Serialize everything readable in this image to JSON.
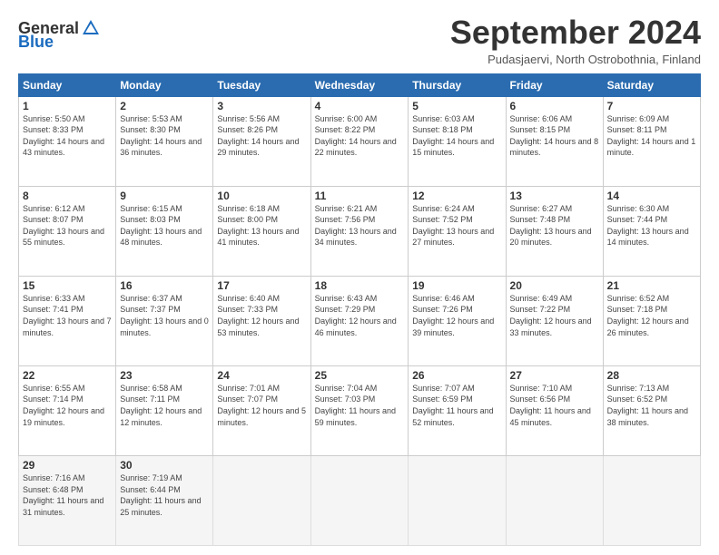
{
  "header": {
    "logo_general": "General",
    "logo_blue": "Blue",
    "month_title": "September 2024",
    "subtitle": "Pudasjaervi, North Ostrobothnia, Finland"
  },
  "weekdays": [
    "Sunday",
    "Monday",
    "Tuesday",
    "Wednesday",
    "Thursday",
    "Friday",
    "Saturday"
  ],
  "weeks": [
    [
      {
        "day": "1",
        "sunrise": "Sunrise: 5:50 AM",
        "sunset": "Sunset: 8:33 PM",
        "daylight": "Daylight: 14 hours and 43 minutes."
      },
      {
        "day": "2",
        "sunrise": "Sunrise: 5:53 AM",
        "sunset": "Sunset: 8:30 PM",
        "daylight": "Daylight: 14 hours and 36 minutes."
      },
      {
        "day": "3",
        "sunrise": "Sunrise: 5:56 AM",
        "sunset": "Sunset: 8:26 PM",
        "daylight": "Daylight: 14 hours and 29 minutes."
      },
      {
        "day": "4",
        "sunrise": "Sunrise: 6:00 AM",
        "sunset": "Sunset: 8:22 PM",
        "daylight": "Daylight: 14 hours and 22 minutes."
      },
      {
        "day": "5",
        "sunrise": "Sunrise: 6:03 AM",
        "sunset": "Sunset: 8:18 PM",
        "daylight": "Daylight: 14 hours and 15 minutes."
      },
      {
        "day": "6",
        "sunrise": "Sunrise: 6:06 AM",
        "sunset": "Sunset: 8:15 PM",
        "daylight": "Daylight: 14 hours and 8 minutes."
      },
      {
        "day": "7",
        "sunrise": "Sunrise: 6:09 AM",
        "sunset": "Sunset: 8:11 PM",
        "daylight": "Daylight: 14 hours and 1 minute."
      }
    ],
    [
      {
        "day": "8",
        "sunrise": "Sunrise: 6:12 AM",
        "sunset": "Sunset: 8:07 PM",
        "daylight": "Daylight: 13 hours and 55 minutes."
      },
      {
        "day": "9",
        "sunrise": "Sunrise: 6:15 AM",
        "sunset": "Sunset: 8:03 PM",
        "daylight": "Daylight: 13 hours and 48 minutes."
      },
      {
        "day": "10",
        "sunrise": "Sunrise: 6:18 AM",
        "sunset": "Sunset: 8:00 PM",
        "daylight": "Daylight: 13 hours and 41 minutes."
      },
      {
        "day": "11",
        "sunrise": "Sunrise: 6:21 AM",
        "sunset": "Sunset: 7:56 PM",
        "daylight": "Daylight: 13 hours and 34 minutes."
      },
      {
        "day": "12",
        "sunrise": "Sunrise: 6:24 AM",
        "sunset": "Sunset: 7:52 PM",
        "daylight": "Daylight: 13 hours and 27 minutes."
      },
      {
        "day": "13",
        "sunrise": "Sunrise: 6:27 AM",
        "sunset": "Sunset: 7:48 PM",
        "daylight": "Daylight: 13 hours and 20 minutes."
      },
      {
        "day": "14",
        "sunrise": "Sunrise: 6:30 AM",
        "sunset": "Sunset: 7:44 PM",
        "daylight": "Daylight: 13 hours and 14 minutes."
      }
    ],
    [
      {
        "day": "15",
        "sunrise": "Sunrise: 6:33 AM",
        "sunset": "Sunset: 7:41 PM",
        "daylight": "Daylight: 13 hours and 7 minutes."
      },
      {
        "day": "16",
        "sunrise": "Sunrise: 6:37 AM",
        "sunset": "Sunset: 7:37 PM",
        "daylight": "Daylight: 13 hours and 0 minutes."
      },
      {
        "day": "17",
        "sunrise": "Sunrise: 6:40 AM",
        "sunset": "Sunset: 7:33 PM",
        "daylight": "Daylight: 12 hours and 53 minutes."
      },
      {
        "day": "18",
        "sunrise": "Sunrise: 6:43 AM",
        "sunset": "Sunset: 7:29 PM",
        "daylight": "Daylight: 12 hours and 46 minutes."
      },
      {
        "day": "19",
        "sunrise": "Sunrise: 6:46 AM",
        "sunset": "Sunset: 7:26 PM",
        "daylight": "Daylight: 12 hours and 39 minutes."
      },
      {
        "day": "20",
        "sunrise": "Sunrise: 6:49 AM",
        "sunset": "Sunset: 7:22 PM",
        "daylight": "Daylight: 12 hours and 33 minutes."
      },
      {
        "day": "21",
        "sunrise": "Sunrise: 6:52 AM",
        "sunset": "Sunset: 7:18 PM",
        "daylight": "Daylight: 12 hours and 26 minutes."
      }
    ],
    [
      {
        "day": "22",
        "sunrise": "Sunrise: 6:55 AM",
        "sunset": "Sunset: 7:14 PM",
        "daylight": "Daylight: 12 hours and 19 minutes."
      },
      {
        "day": "23",
        "sunrise": "Sunrise: 6:58 AM",
        "sunset": "Sunset: 7:11 PM",
        "daylight": "Daylight: 12 hours and 12 minutes."
      },
      {
        "day": "24",
        "sunrise": "Sunrise: 7:01 AM",
        "sunset": "Sunset: 7:07 PM",
        "daylight": "Daylight: 12 hours and 5 minutes."
      },
      {
        "day": "25",
        "sunrise": "Sunrise: 7:04 AM",
        "sunset": "Sunset: 7:03 PM",
        "daylight": "Daylight: 11 hours and 59 minutes."
      },
      {
        "day": "26",
        "sunrise": "Sunrise: 7:07 AM",
        "sunset": "Sunset: 6:59 PM",
        "daylight": "Daylight: 11 hours and 52 minutes."
      },
      {
        "day": "27",
        "sunrise": "Sunrise: 7:10 AM",
        "sunset": "Sunset: 6:56 PM",
        "daylight": "Daylight: 11 hours and 45 minutes."
      },
      {
        "day": "28",
        "sunrise": "Sunrise: 7:13 AM",
        "sunset": "Sunset: 6:52 PM",
        "daylight": "Daylight: 11 hours and 38 minutes."
      }
    ],
    [
      {
        "day": "29",
        "sunrise": "Sunrise: 7:16 AM",
        "sunset": "Sunset: 6:48 PM",
        "daylight": "Daylight: 11 hours and 31 minutes."
      },
      {
        "day": "30",
        "sunrise": "Sunrise: 7:19 AM",
        "sunset": "Sunset: 6:44 PM",
        "daylight": "Daylight: 11 hours and 25 minutes."
      },
      null,
      null,
      null,
      null,
      null
    ]
  ]
}
